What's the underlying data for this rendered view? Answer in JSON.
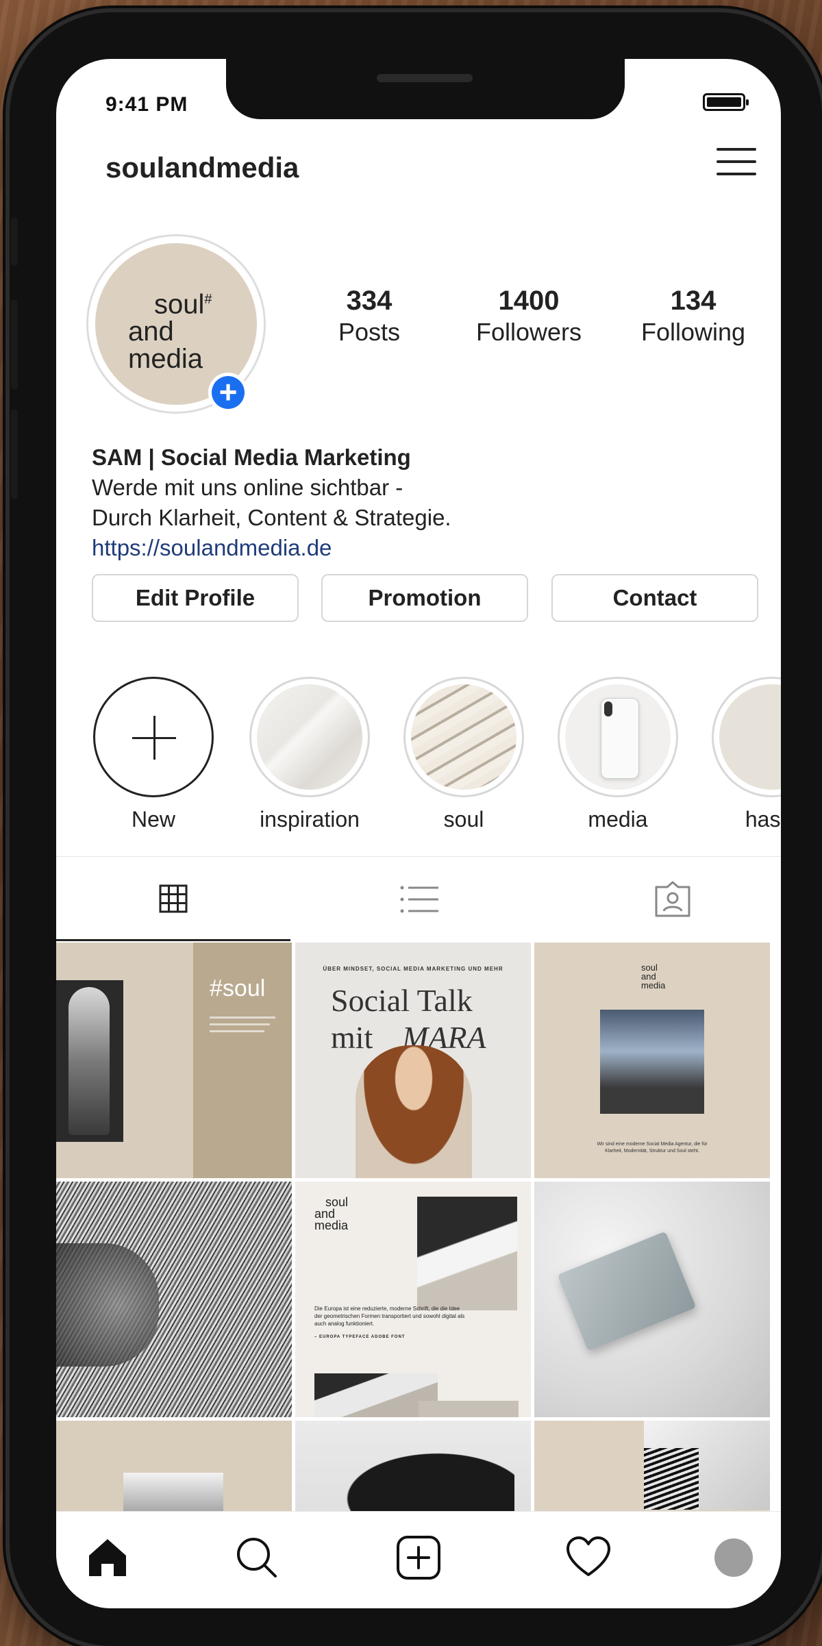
{
  "status": {
    "time": "9:41 PM"
  },
  "header": {
    "username": "soulandmedia",
    "menu_icon": "hamburger-menu-icon"
  },
  "profile": {
    "avatar_logo": {
      "line1": "soul",
      "mark": "#",
      "line2": "and",
      "line3": "media"
    },
    "stats": [
      {
        "value": "334",
        "label": "Posts"
      },
      {
        "value": "1400",
        "label": "Followers"
      },
      {
        "value": "134",
        "label": "Following"
      }
    ],
    "bio": {
      "name": "SAM | Social Media Marketing",
      "line1": "Werde mit uns online sichtbar -",
      "line2": "Durch Klarheit, Content & Strategie.",
      "link": "https://soulandmedia.de"
    },
    "buttons": {
      "edit": "Edit Profile",
      "promotion": "Promotion",
      "contact": "Contact"
    }
  },
  "highlights": [
    {
      "label": "New"
    },
    {
      "label": "inspiration"
    },
    {
      "label": "soul"
    },
    {
      "label": "media"
    },
    {
      "label": "hasht"
    }
  ],
  "tabs": [
    "grid-icon",
    "list-icon",
    "tagged-icon"
  ],
  "posts": [
    {
      "title": "#soul"
    },
    {
      "kicker": "ÜBER MINDSET, SOCIAL MEDIA MARKETING UND MEHR",
      "title1": "Social Talk",
      "title2": "mit",
      "title3": "MARA"
    },
    {
      "logo1": "soul",
      "logo2": "and",
      "logo3": "media",
      "caption": "Wir sind eine moderne Social Media Agentur, die für Klarheit, Modernität, Struktur und Soul steht."
    },
    {
      "type": "photo"
    },
    {
      "logo1": "soul",
      "logo2": "and",
      "logo3": "media",
      "body": "Die Europa ist eine reduzierte, moderne Schrift, die die Idee der geometrischen Formen transportiert und sowohl digital als auch analog funktioniert.",
      "credit": "– EUROPA TYPEFACE ADOBE FONT"
    },
    {
      "type": "photo"
    },
    {
      "type": "photo"
    },
    {
      "type": "photo"
    },
    {
      "type": "photo"
    }
  ],
  "bottom_nav": [
    "home-icon",
    "search-icon",
    "add-post-icon",
    "heart-icon",
    "profile-icon"
  ],
  "colors": {
    "accent": "#1a6ff0",
    "beige": "#dcd1c1",
    "link": "#1f3c7a"
  }
}
